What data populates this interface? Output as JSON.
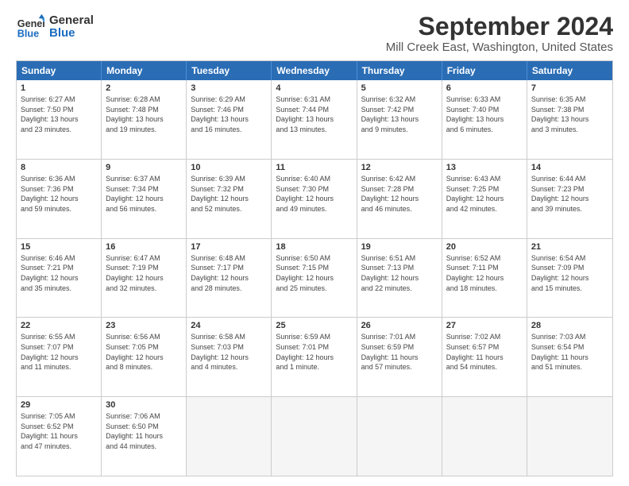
{
  "logo": {
    "line1": "General",
    "line2": "Blue"
  },
  "title": "September 2024",
  "subtitle": "Mill Creek East, Washington, United States",
  "header_days": [
    "Sunday",
    "Monday",
    "Tuesday",
    "Wednesday",
    "Thursday",
    "Friday",
    "Saturday"
  ],
  "weeks": [
    [
      {
        "day": "1",
        "info": "Sunrise: 6:27 AM\nSunset: 7:50 PM\nDaylight: 13 hours\nand 23 minutes."
      },
      {
        "day": "2",
        "info": "Sunrise: 6:28 AM\nSunset: 7:48 PM\nDaylight: 13 hours\nand 19 minutes."
      },
      {
        "day": "3",
        "info": "Sunrise: 6:29 AM\nSunset: 7:46 PM\nDaylight: 13 hours\nand 16 minutes."
      },
      {
        "day": "4",
        "info": "Sunrise: 6:31 AM\nSunset: 7:44 PM\nDaylight: 13 hours\nand 13 minutes."
      },
      {
        "day": "5",
        "info": "Sunrise: 6:32 AM\nSunset: 7:42 PM\nDaylight: 13 hours\nand 9 minutes."
      },
      {
        "day": "6",
        "info": "Sunrise: 6:33 AM\nSunset: 7:40 PM\nDaylight: 13 hours\nand 6 minutes."
      },
      {
        "day": "7",
        "info": "Sunrise: 6:35 AM\nSunset: 7:38 PM\nDaylight: 13 hours\nand 3 minutes."
      }
    ],
    [
      {
        "day": "8",
        "info": "Sunrise: 6:36 AM\nSunset: 7:36 PM\nDaylight: 12 hours\nand 59 minutes."
      },
      {
        "day": "9",
        "info": "Sunrise: 6:37 AM\nSunset: 7:34 PM\nDaylight: 12 hours\nand 56 minutes."
      },
      {
        "day": "10",
        "info": "Sunrise: 6:39 AM\nSunset: 7:32 PM\nDaylight: 12 hours\nand 52 minutes."
      },
      {
        "day": "11",
        "info": "Sunrise: 6:40 AM\nSunset: 7:30 PM\nDaylight: 12 hours\nand 49 minutes."
      },
      {
        "day": "12",
        "info": "Sunrise: 6:42 AM\nSunset: 7:28 PM\nDaylight: 12 hours\nand 46 minutes."
      },
      {
        "day": "13",
        "info": "Sunrise: 6:43 AM\nSunset: 7:25 PM\nDaylight: 12 hours\nand 42 minutes."
      },
      {
        "day": "14",
        "info": "Sunrise: 6:44 AM\nSunset: 7:23 PM\nDaylight: 12 hours\nand 39 minutes."
      }
    ],
    [
      {
        "day": "15",
        "info": "Sunrise: 6:46 AM\nSunset: 7:21 PM\nDaylight: 12 hours\nand 35 minutes."
      },
      {
        "day": "16",
        "info": "Sunrise: 6:47 AM\nSunset: 7:19 PM\nDaylight: 12 hours\nand 32 minutes."
      },
      {
        "day": "17",
        "info": "Sunrise: 6:48 AM\nSunset: 7:17 PM\nDaylight: 12 hours\nand 28 minutes."
      },
      {
        "day": "18",
        "info": "Sunrise: 6:50 AM\nSunset: 7:15 PM\nDaylight: 12 hours\nand 25 minutes."
      },
      {
        "day": "19",
        "info": "Sunrise: 6:51 AM\nSunset: 7:13 PM\nDaylight: 12 hours\nand 22 minutes."
      },
      {
        "day": "20",
        "info": "Sunrise: 6:52 AM\nSunset: 7:11 PM\nDaylight: 12 hours\nand 18 minutes."
      },
      {
        "day": "21",
        "info": "Sunrise: 6:54 AM\nSunset: 7:09 PM\nDaylight: 12 hours\nand 15 minutes."
      }
    ],
    [
      {
        "day": "22",
        "info": "Sunrise: 6:55 AM\nSunset: 7:07 PM\nDaylight: 12 hours\nand 11 minutes."
      },
      {
        "day": "23",
        "info": "Sunrise: 6:56 AM\nSunset: 7:05 PM\nDaylight: 12 hours\nand 8 minutes."
      },
      {
        "day": "24",
        "info": "Sunrise: 6:58 AM\nSunset: 7:03 PM\nDaylight: 12 hours\nand 4 minutes."
      },
      {
        "day": "25",
        "info": "Sunrise: 6:59 AM\nSunset: 7:01 PM\nDaylight: 12 hours\nand 1 minute."
      },
      {
        "day": "26",
        "info": "Sunrise: 7:01 AM\nSunset: 6:59 PM\nDaylight: 11 hours\nand 57 minutes."
      },
      {
        "day": "27",
        "info": "Sunrise: 7:02 AM\nSunset: 6:57 PM\nDaylight: 11 hours\nand 54 minutes."
      },
      {
        "day": "28",
        "info": "Sunrise: 7:03 AM\nSunset: 6:54 PM\nDaylight: 11 hours\nand 51 minutes."
      }
    ],
    [
      {
        "day": "29",
        "info": "Sunrise: 7:05 AM\nSunset: 6:52 PM\nDaylight: 11 hours\nand 47 minutes."
      },
      {
        "day": "30",
        "info": "Sunrise: 7:06 AM\nSunset: 6:50 PM\nDaylight: 11 hours\nand 44 minutes."
      },
      {
        "day": "",
        "info": ""
      },
      {
        "day": "",
        "info": ""
      },
      {
        "day": "",
        "info": ""
      },
      {
        "day": "",
        "info": ""
      },
      {
        "day": "",
        "info": ""
      }
    ]
  ]
}
